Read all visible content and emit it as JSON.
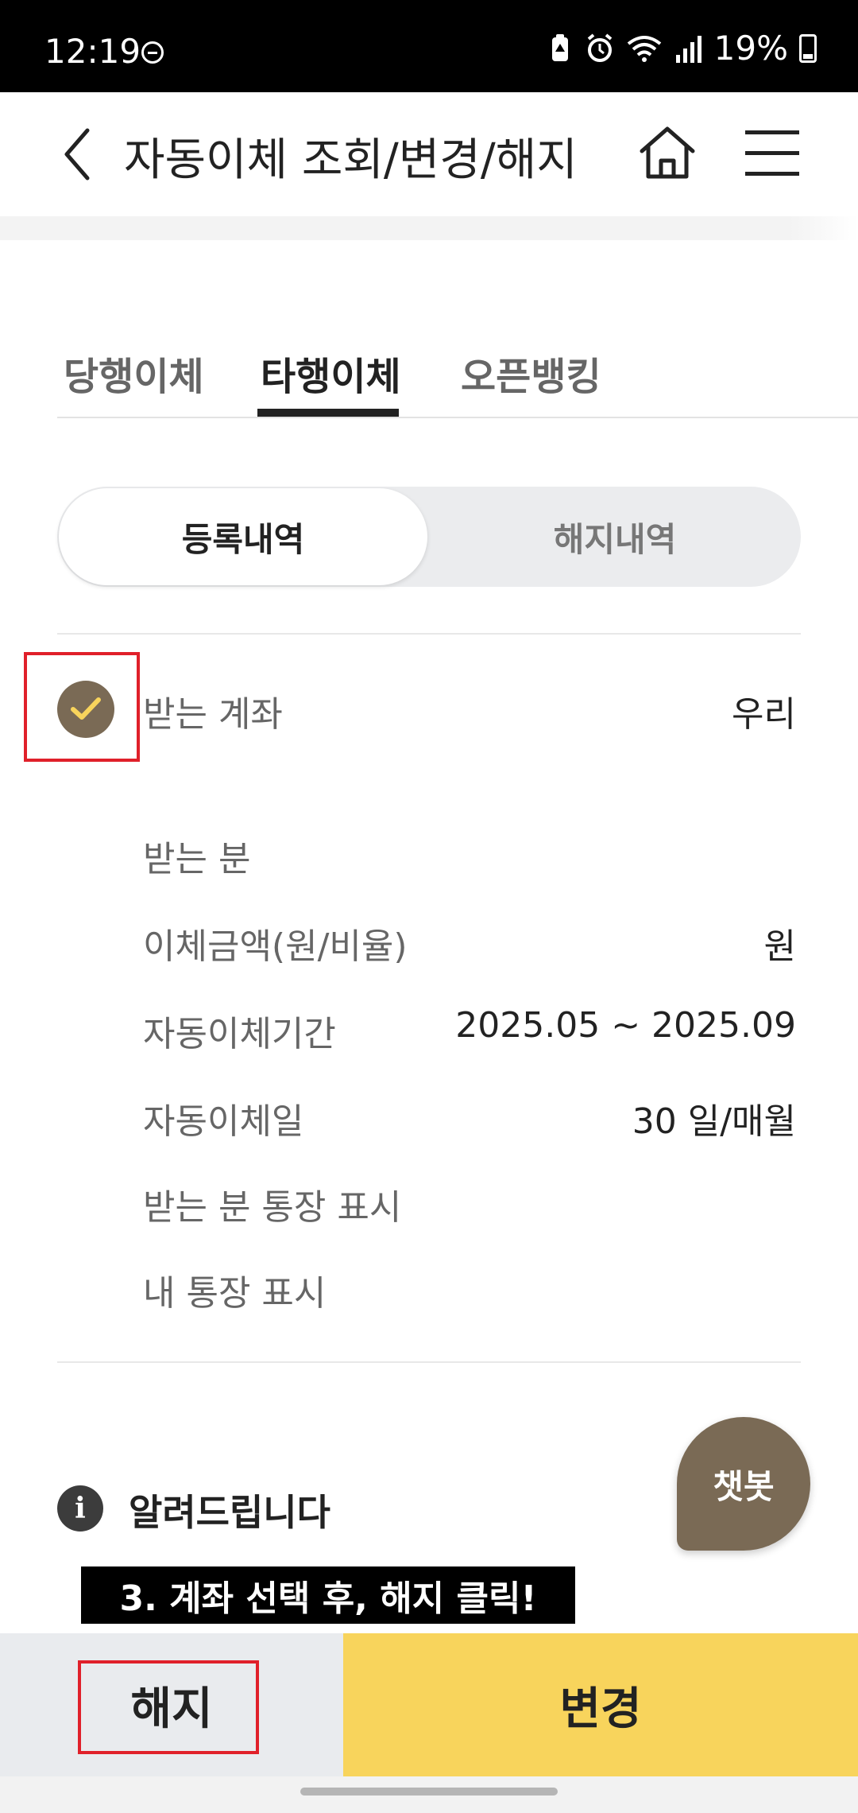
{
  "status_bar": {
    "time": "12:19",
    "battery_percent": "19%",
    "icons": [
      "do-not-disturb-icon",
      "battery-saver-icon",
      "alarm-icon",
      "wifi-icon",
      "signal-icon",
      "battery-icon"
    ]
  },
  "header": {
    "title": "자동이체 조회/변경/해지",
    "icons": [
      "back-arrow-icon",
      "home-icon",
      "hamburger-menu-icon"
    ]
  },
  "tabs": [
    {
      "label": "당행이체",
      "active": false
    },
    {
      "label": "타행이체",
      "active": true
    },
    {
      "label": "오픈뱅킹",
      "active": false
    }
  ],
  "segment": {
    "active": "등록내역",
    "inactive": "해지내역"
  },
  "transfer": {
    "checked": true,
    "rows": [
      {
        "label": "받는 계좌",
        "value": "우리"
      },
      {
        "label": "받는 분",
        "value": ""
      },
      {
        "label": "이체금액(원/비율)",
        "value": "원"
      },
      {
        "label": "자동이체기간",
        "value": "2025.05 ~ 2025.09"
      },
      {
        "label": "자동이체일",
        "value": "30 일/매월"
      },
      {
        "label": "받는 분 통장 표시",
        "value": ""
      },
      {
        "label": "내 통장 표시",
        "value": ""
      }
    ]
  },
  "notice": {
    "icon": "info-icon",
    "title": "알려드립니다"
  },
  "chatbot": {
    "label": "챗봇"
  },
  "annotation": {
    "text": "3. 계좌 선택 후, 해지 클릭!"
  },
  "buttons": {
    "cancel": "해지",
    "change": "변경"
  },
  "colors": {
    "accent_yellow": "#f8d45c",
    "check_brown": "#7a6a55",
    "highlight_red": "#e0202a"
  }
}
